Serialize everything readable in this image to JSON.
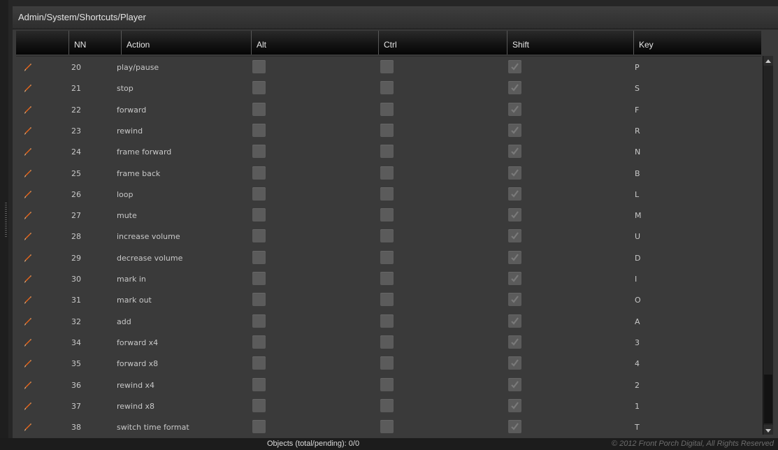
{
  "breadcrumb": "Admin/System/Shortcuts/Player",
  "columns": [
    "",
    "NN",
    "Action",
    "Alt",
    "Ctrl",
    "Shift",
    "Key"
  ],
  "rows": [
    {
      "nn": "20",
      "action": "play/pause",
      "alt": false,
      "ctrl": false,
      "shift": true,
      "key": "P"
    },
    {
      "nn": "21",
      "action": "stop",
      "alt": false,
      "ctrl": false,
      "shift": true,
      "key": "S"
    },
    {
      "nn": "22",
      "action": "forward",
      "alt": false,
      "ctrl": false,
      "shift": true,
      "key": "F"
    },
    {
      "nn": "23",
      "action": "rewind",
      "alt": false,
      "ctrl": false,
      "shift": true,
      "key": "R"
    },
    {
      "nn": "24",
      "action": "frame forward",
      "alt": false,
      "ctrl": false,
      "shift": true,
      "key": "N"
    },
    {
      "nn": "25",
      "action": "frame back",
      "alt": false,
      "ctrl": false,
      "shift": true,
      "key": "B"
    },
    {
      "nn": "26",
      "action": "loop",
      "alt": false,
      "ctrl": false,
      "shift": true,
      "key": "L"
    },
    {
      "nn": "27",
      "action": "mute",
      "alt": false,
      "ctrl": false,
      "shift": true,
      "key": "M"
    },
    {
      "nn": "28",
      "action": "increase volume",
      "alt": false,
      "ctrl": false,
      "shift": true,
      "key": "U"
    },
    {
      "nn": "29",
      "action": "decrease volume",
      "alt": false,
      "ctrl": false,
      "shift": true,
      "key": "D"
    },
    {
      "nn": "30",
      "action": "mark in",
      "alt": false,
      "ctrl": false,
      "shift": true,
      "key": "I"
    },
    {
      "nn": "31",
      "action": "mark out",
      "alt": false,
      "ctrl": false,
      "shift": true,
      "key": "O"
    },
    {
      "nn": "32",
      "action": "add",
      "alt": false,
      "ctrl": false,
      "shift": true,
      "key": "A"
    },
    {
      "nn": "34",
      "action": "forward x4",
      "alt": false,
      "ctrl": false,
      "shift": true,
      "key": "3"
    },
    {
      "nn": "35",
      "action": "forward x8",
      "alt": false,
      "ctrl": false,
      "shift": true,
      "key": "4"
    },
    {
      "nn": "36",
      "action": "rewind x4",
      "alt": false,
      "ctrl": false,
      "shift": true,
      "key": "2"
    },
    {
      "nn": "37",
      "action": "rewind x8",
      "alt": false,
      "ctrl": false,
      "shift": true,
      "key": "1"
    },
    {
      "nn": "38",
      "action": "switch time format",
      "alt": false,
      "ctrl": false,
      "shift": true,
      "key": "T"
    }
  ],
  "status": {
    "objects": "Objects (total/pending): 0/0",
    "copyright": "© 2012 Front Porch Digital, All Rights Reserved"
  },
  "icons": {
    "edit": "pencil-icon",
    "scroll_up": "scroll-up-icon",
    "scroll_down": "scroll-down-icon",
    "check": "check-icon"
  },
  "colors": {
    "pencil": "#e8661a",
    "background": "#3a3a3a"
  }
}
